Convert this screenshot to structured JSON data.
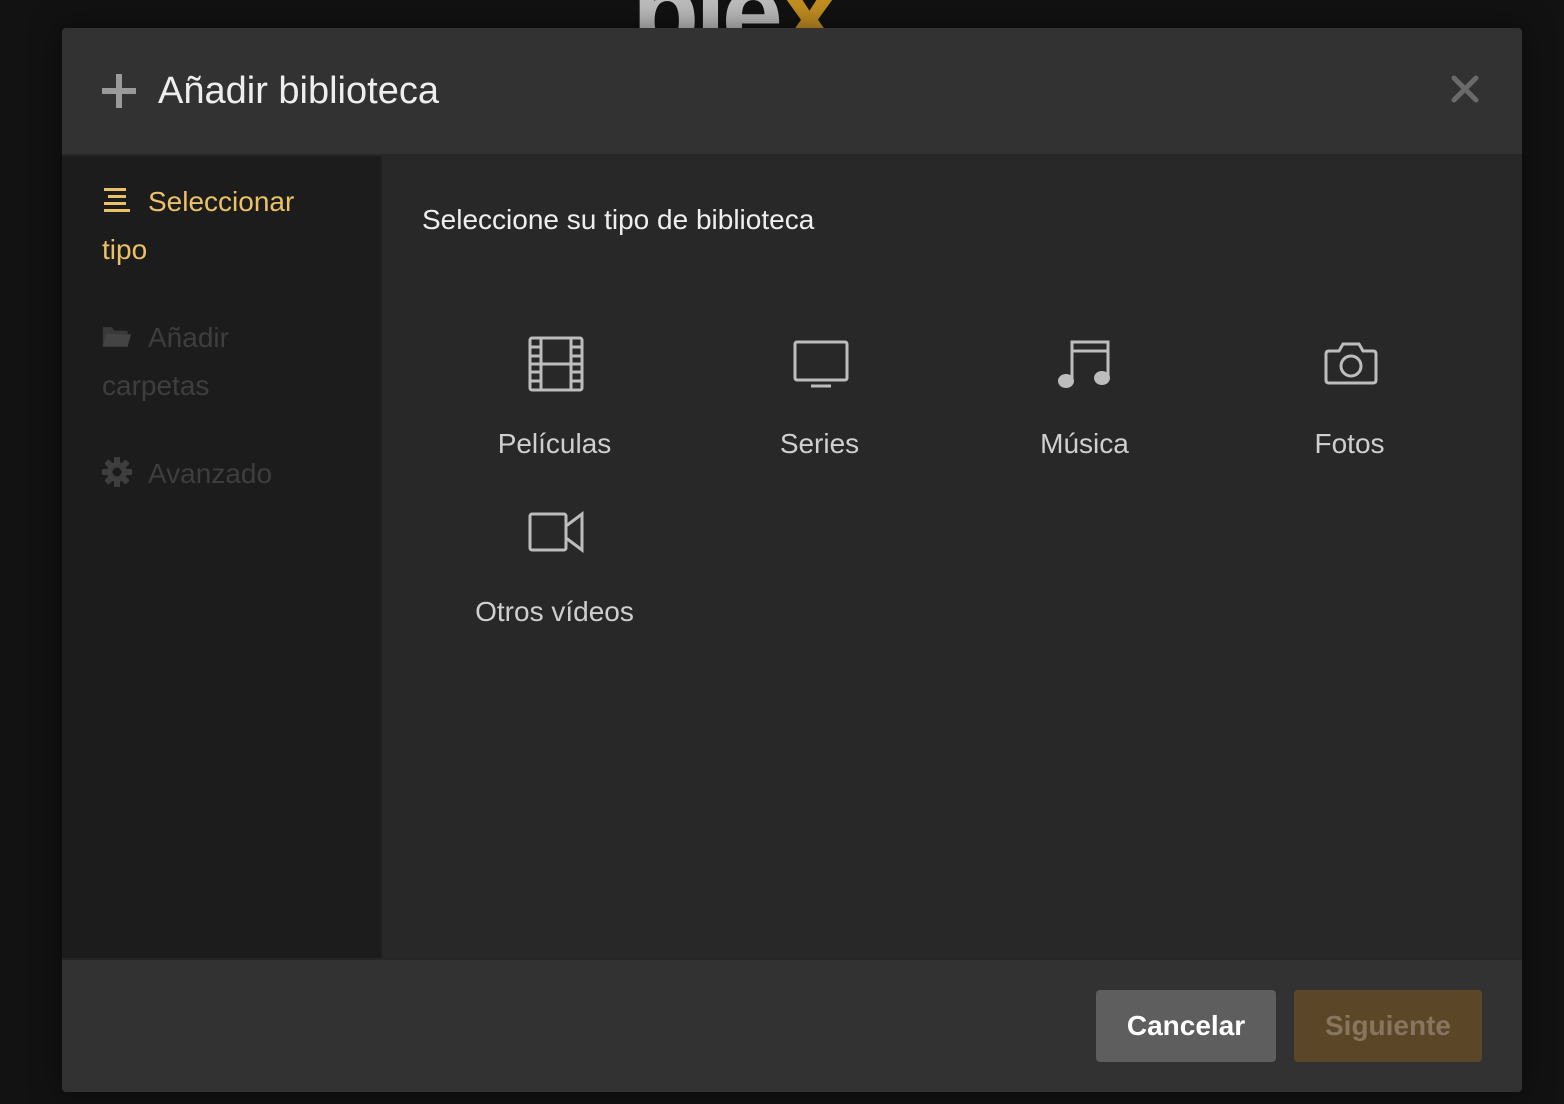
{
  "background": {
    "logo_text": "ple",
    "logo_accent": "x"
  },
  "modal": {
    "title": "Añadir biblioteca",
    "icons": {
      "title": "plus-icon",
      "close": "close-icon"
    }
  },
  "sidebar": {
    "steps": [
      {
        "label": "Seleccionar tipo",
        "icon": "list-icon",
        "state": "active"
      },
      {
        "label": "Añadir carpetas",
        "icon": "folder-icon",
        "state": "disabled"
      },
      {
        "label": "Avanzado",
        "icon": "gear-icon",
        "state": "disabled"
      }
    ]
  },
  "content": {
    "title": "Seleccione su tipo de biblioteca",
    "types": [
      {
        "label": "Películas",
        "icon": "film-icon"
      },
      {
        "label": "Series",
        "icon": "tv-icon"
      },
      {
        "label": "Música",
        "icon": "music-icon"
      },
      {
        "label": "Fotos",
        "icon": "camera-icon"
      },
      {
        "label": "Otros vídeos",
        "icon": "video-camera-icon"
      }
    ]
  },
  "footer": {
    "cancel_label": "Cancelar",
    "next_label": "Siguiente"
  },
  "colors": {
    "accent": "#ebc165",
    "brand": "#e5a00d",
    "next_button_bg": "#5c4628",
    "cancel_button_bg": "#5e5e5e"
  }
}
